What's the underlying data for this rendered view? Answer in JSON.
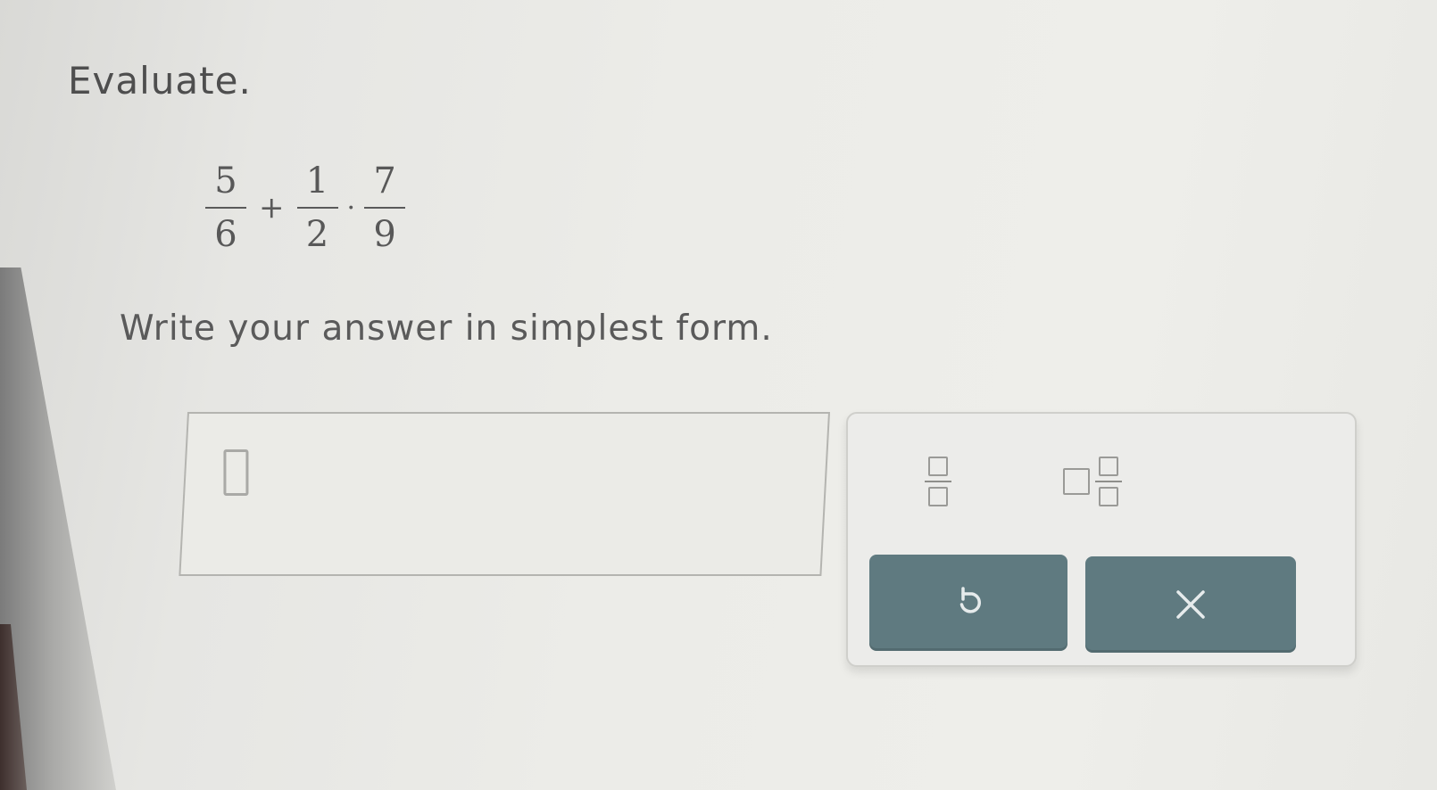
{
  "problem": {
    "prompt": "Evaluate.",
    "instruction": "Write your answer in simplest form.",
    "expression": {
      "term1": {
        "numerator": "5",
        "denominator": "6"
      },
      "op1": "+",
      "term2": {
        "numerator": "1",
        "denominator": "2"
      },
      "op2": "·",
      "term3": {
        "numerator": "7",
        "denominator": "9"
      }
    }
  },
  "answer": {
    "value": ""
  },
  "keypad": {
    "buttons": [
      {
        "name": "fraction-template",
        "icon": "fraction-icon"
      },
      {
        "name": "mixed-number-template",
        "icon": "mixed-number-icon"
      },
      {
        "name": "undo",
        "icon": "undo-icon"
      },
      {
        "name": "clear",
        "icon": "x-icon"
      }
    ]
  },
  "colors": {
    "button_fill": "#5f7a80",
    "button_icon": "#e6ebec",
    "text": "#4e4e4e",
    "border": "#b4b4b0"
  }
}
